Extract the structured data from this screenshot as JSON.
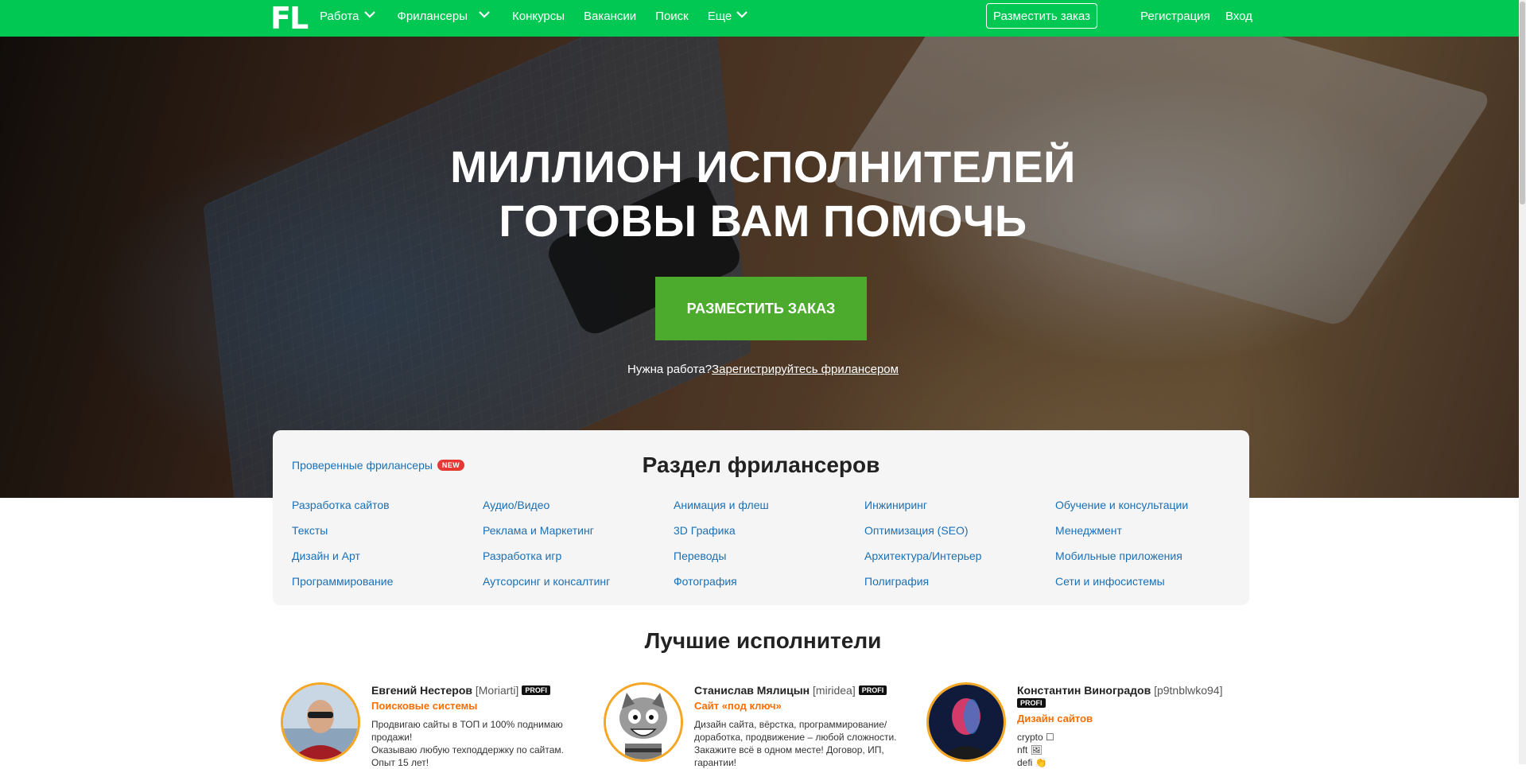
{
  "header": {
    "logo": "FL",
    "nav": [
      {
        "label": "Работа",
        "dropdown": true
      },
      {
        "label": "Фрилансеры",
        "dropdown": true
      },
      {
        "label": "Конкурсы",
        "dropdown": false
      },
      {
        "label": "Вакансии",
        "dropdown": false
      },
      {
        "label": "Поиск",
        "dropdown": false
      },
      {
        "label": "Еще",
        "dropdown": true
      }
    ],
    "post_order_button": "Разместить заказ",
    "register": "Регистрация",
    "login": "Вход"
  },
  "hero": {
    "title_line1": "МИЛЛИОН ИСПОЛНИТЕЛЕЙ",
    "title_line2": "ГОТОВЫ ВАМ ПОМОЧЬ",
    "cta": "РАЗМЕСТИТЬ ЗАКАЗ",
    "note_text": "Нужна работа?",
    "note_link": "Зарегистрируйтесь фрилансером"
  },
  "freelancers_section": {
    "title": "Раздел фрилансеров",
    "verified_link": "Проверенные фрилансеры",
    "new_badge": "NEW",
    "columns": [
      [
        "Разработка сайтов",
        "Тексты",
        "Дизайн и Арт",
        "Программирование"
      ],
      [
        "Аудио/Видео",
        "Реклама и Маркетинг",
        "Разработка игр",
        "Аутсорсинг и консалтинг"
      ],
      [
        "Анимация и флеш",
        "3D Графика",
        "Переводы",
        "Фотография"
      ],
      [
        "Инжиниринг",
        "Оптимизация (SEO)",
        "Архитектура/Интерьер",
        "Полиграфия"
      ],
      [
        "Обучение и консультации",
        "Менеджмент",
        "Мобильные приложения",
        "Сети и инфосистемы"
      ]
    ]
  },
  "best": {
    "title": "Лучшие исполнители",
    "performers": [
      {
        "name": "Евгений Нестеров",
        "login": "[Moriarti]",
        "badge": "PROFI",
        "specialty": "Поисковые системы",
        "desc": [
          "Продвигаю сайты в ТОП и 100% поднимаю продажи!",
          "Оказываю любую техподдержку по сайтам.",
          "Опыт 15 лет!"
        ]
      },
      {
        "name": "Станислав Мялицын",
        "login": "[miridea]",
        "badge": "PROFI",
        "specialty": "Сайт «под ключ»",
        "desc": [
          "Дизайн сайта, вёрстка, программирование/доработка, продвижение – любой сложности.",
          "Закажите всё в одном месте! Договор, ИП, гарантии!"
        ]
      },
      {
        "name": "Константин Виноградов",
        "login": "[p9tnblwko94]",
        "badge": "PROFI",
        "specialty": "Дизайн сайтов",
        "desc": [
          "crypto ☐",
          "nft 🖼",
          "defi 👏"
        ]
      }
    ]
  },
  "colors": {
    "header_green": "#00c853",
    "cta_green": "#4caa2c",
    "link_blue": "#1b6fb5",
    "specialty_orange": "#ff6d00",
    "avatar_ring": "#f5a623"
  }
}
